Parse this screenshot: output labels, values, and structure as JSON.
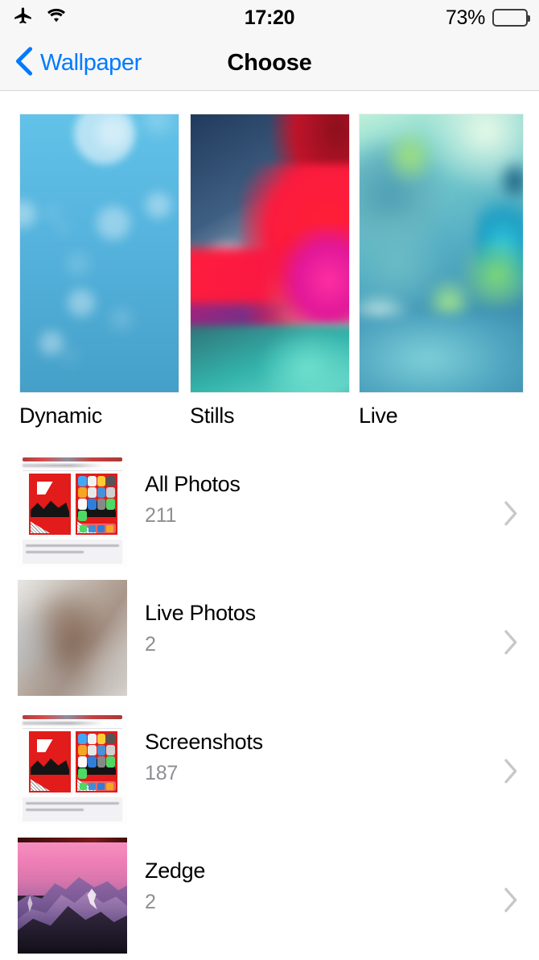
{
  "status_bar": {
    "airplane_icon": "airplane-mode-icon",
    "wifi_icon": "wifi-icon",
    "time": "17:20",
    "battery_percent": "73%",
    "battery_level": 73
  },
  "nav_bar": {
    "back_icon": "chevron-left-icon",
    "back_label": "Wallpaper",
    "title": "Choose"
  },
  "categories": [
    {
      "label": "Dynamic",
      "thumbnail": "dynamic-wallpaper-preview"
    },
    {
      "label": "Stills",
      "thumbnail": "stills-wallpaper-preview"
    },
    {
      "label": "Live",
      "thumbnail": "live-wallpaper-preview"
    }
  ],
  "albums": [
    {
      "title": "All Photos",
      "count": "211",
      "thumbnail": "persona5-screenshot-thumbnail",
      "chevron": "chevron-right-icon"
    },
    {
      "title": "Live Photos",
      "count": "2",
      "thumbnail": "blurred-photo-thumbnail",
      "chevron": "chevron-right-icon"
    },
    {
      "title": "Screenshots",
      "count": "187",
      "thumbnail": "persona5-screenshot-thumbnail",
      "chevron": "chevron-right-icon"
    },
    {
      "title": "Zedge",
      "count": "2",
      "thumbnail": "mountain-sunset-thumbnail",
      "chevron": "chevron-right-icon"
    }
  ],
  "colors": {
    "accent_blue": "#007AFF",
    "bar_background": "#f7f7f7",
    "secondary_text": "#8e8e93",
    "chevron_gray": "#c7c7cc",
    "page_background": "#ffffff"
  }
}
